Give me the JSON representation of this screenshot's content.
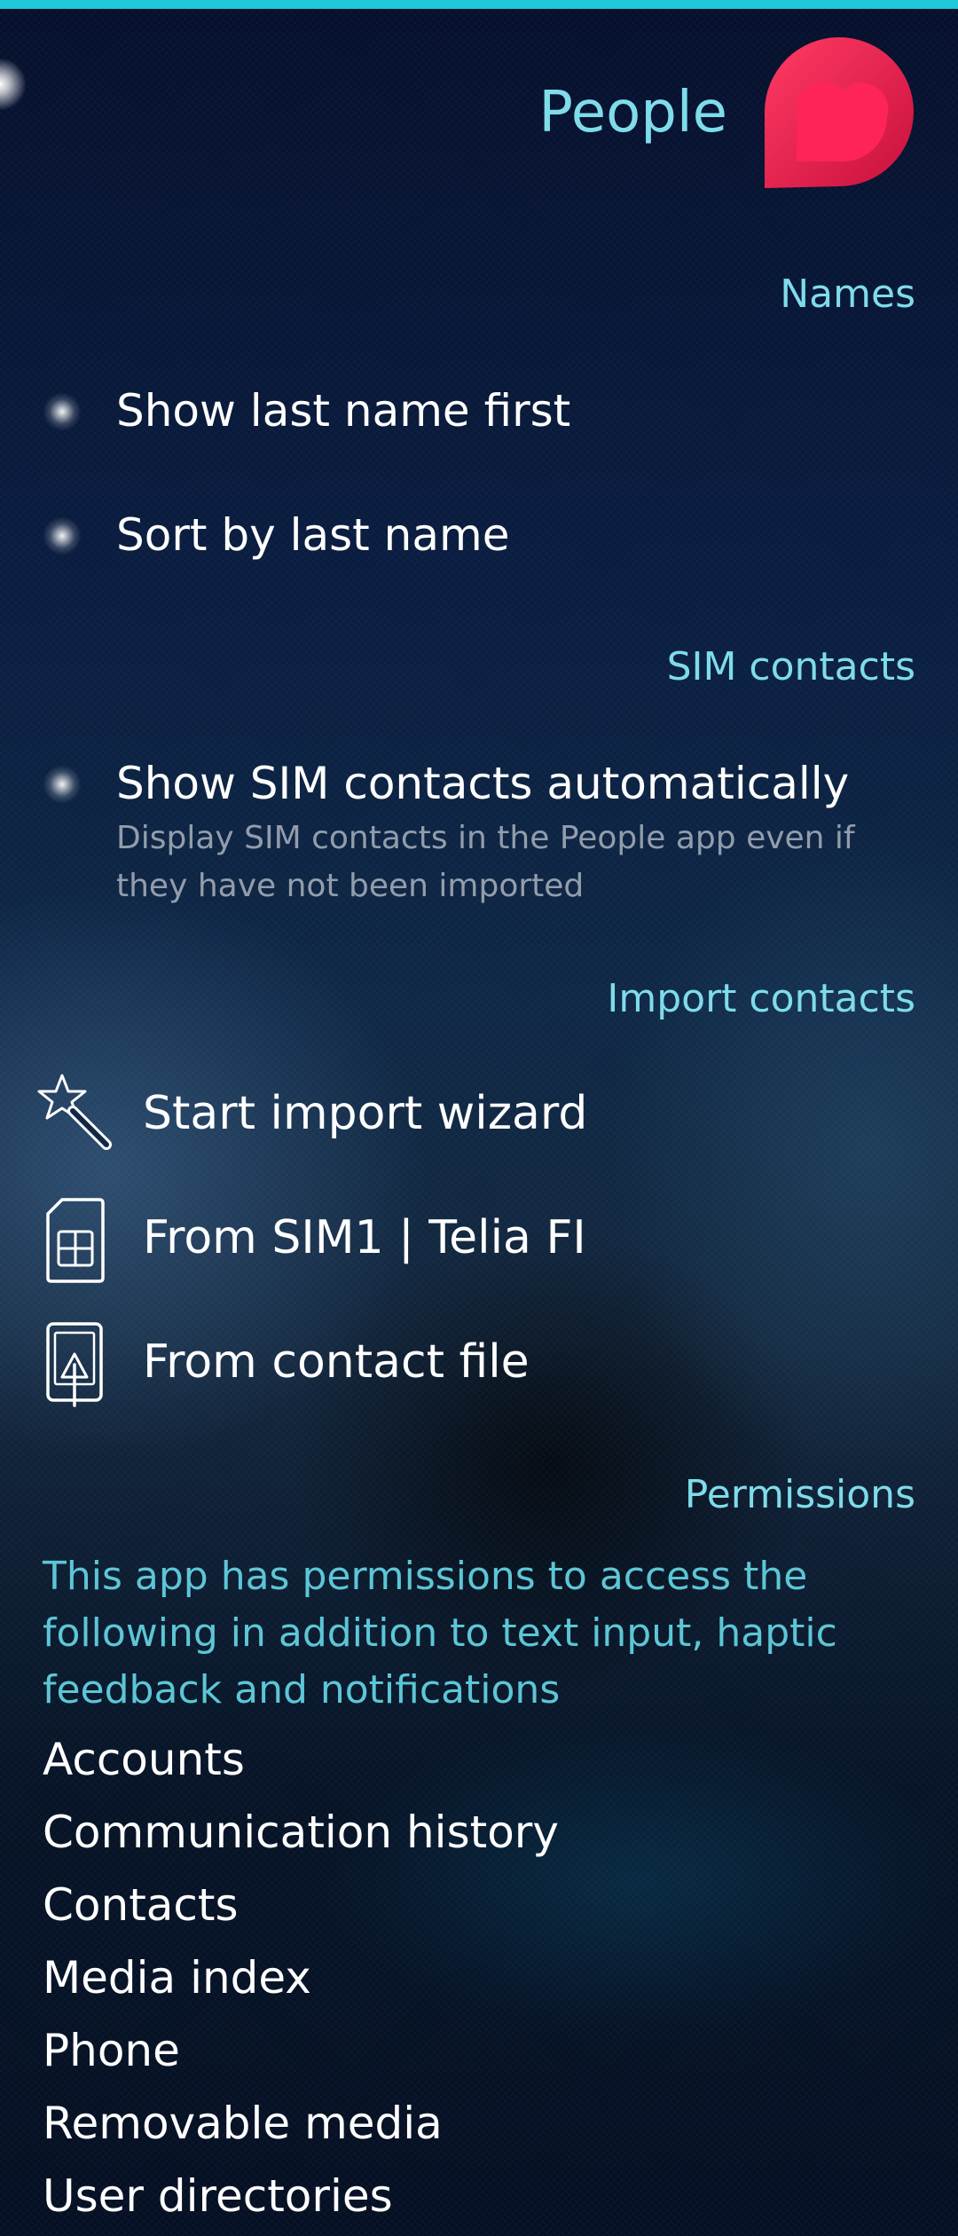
{
  "header": {
    "title": "People"
  },
  "sections": {
    "names": {
      "header": "Names",
      "show_last_name_first": "Show last name first",
      "sort_by_last_name": "Sort by last name"
    },
    "sim_contacts": {
      "header": "SIM contacts",
      "show_sim_auto": "Show SIM contacts automatically",
      "show_sim_auto_desc": "Display SIM contacts in the People app even if they have not been imported"
    },
    "import_contacts": {
      "header": "Import contacts",
      "items": [
        {
          "label": "Start import wizard",
          "icon": "import-wizard-icon"
        },
        {
          "label": "From SIM1 | Telia FI",
          "icon": "sim-card-icon"
        },
        {
          "label": "From contact file",
          "icon": "contact-file-icon"
        }
      ]
    },
    "permissions": {
      "header": "Permissions",
      "description": "This app has permissions to access the following in addition to text input, haptic feedback and notifications",
      "items": [
        "Accounts",
        "Communication history",
        "Contacts",
        "Media index",
        "Phone",
        "Removable media",
        "User directories"
      ]
    }
  },
  "colors": {
    "accent": "#1ec8d8",
    "highlight_text": "#7fdcea",
    "brand_icon": "#f0204f"
  }
}
